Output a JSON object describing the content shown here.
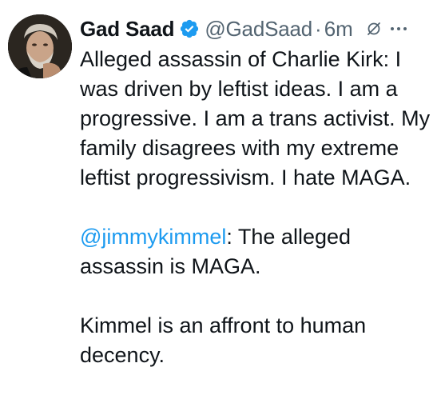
{
  "tweet": {
    "author": {
      "display_name": "Gad Saad",
      "handle": "@GadSaad",
      "verified": true,
      "verified_color": "#1d9bf0"
    },
    "timestamp": "6m",
    "separator": "·",
    "icons": {
      "avatar": "avatar-photo",
      "verified": "verified-badge-icon",
      "grok": "grok-icon",
      "more": "more-options-icon"
    },
    "body": {
      "paragraph1": "Alleged assassin of Charlie Kirk:  I was driven by leftist ideas. I am a progressive. I am a trans activist. My family disagrees with my extreme leftist progressivism. I hate MAGA.",
      "mention": "@jimmykimmel",
      "paragraph2_rest": ":  The alleged assassin is MAGA.",
      "paragraph3": "Kimmel is an affront to human decency."
    },
    "colors": {
      "text": "#0f1419",
      "muted": "#536471",
      "link": "#1d9bf0"
    }
  }
}
